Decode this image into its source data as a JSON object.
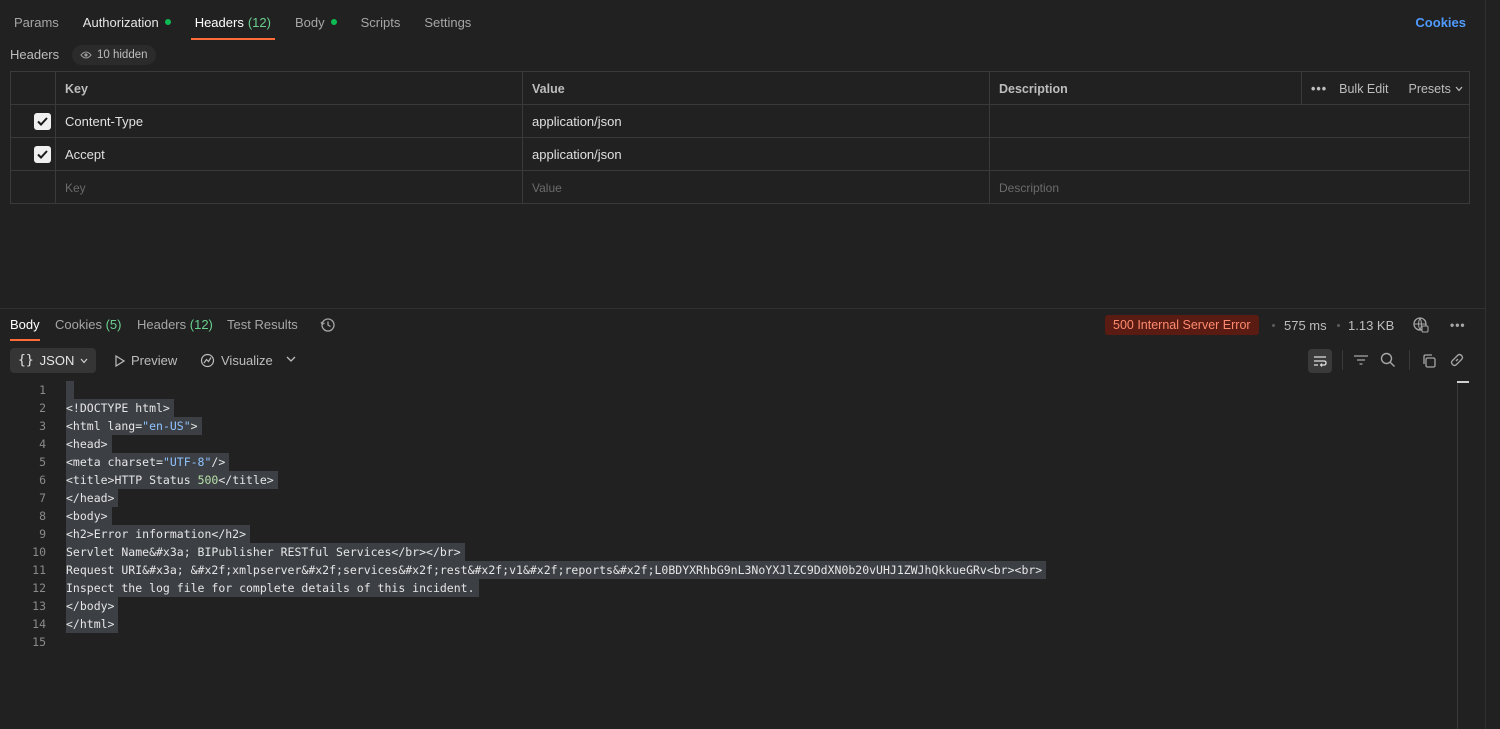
{
  "request_tabs": [
    {
      "label": "Params"
    },
    {
      "label": "Authorization",
      "dot": true
    },
    {
      "label": "Headers",
      "count": "(12)",
      "active": true
    },
    {
      "label": "Body",
      "dot": true
    },
    {
      "label": "Scripts"
    },
    {
      "label": "Settings"
    }
  ],
  "cookies_link": "Cookies",
  "headers_section": {
    "title": "Headers",
    "hidden_label": "10 hidden",
    "columns": {
      "key": "Key",
      "value": "Value",
      "description": "Description"
    },
    "bulk_edit": "Bulk Edit",
    "presets": "Presets",
    "rows": [
      {
        "key": "Content-Type",
        "value": "application/json",
        "description": "",
        "checked": true
      },
      {
        "key": "Accept",
        "value": "application/json",
        "description": "",
        "checked": true
      }
    ],
    "placeholders": {
      "key": "Key",
      "value": "Value",
      "description": "Description"
    }
  },
  "response": {
    "tabs": {
      "body": "Body",
      "cookies": "Cookies",
      "cookies_count": "(5)",
      "headers": "Headers",
      "headers_count": "(12)",
      "test_results": "Test Results"
    },
    "status": "500 Internal Server Error",
    "time": "575 ms",
    "size": "1.13 KB",
    "format": "JSON",
    "preview": "Preview",
    "visualize": "Visualize",
    "lines": [
      "1",
      "2",
      "3",
      "4",
      "5",
      "6",
      "7",
      "8",
      "9",
      "10",
      "11",
      "12",
      "13",
      "14",
      "15"
    ],
    "code": {
      "l2": "<!DOCTYPE html>",
      "l3a": "<html lang=",
      "l3b": "\"en-US\"",
      "l3c": ">",
      "l4": "<head>",
      "l5a": "<meta charset=",
      "l5b": "\"UTF-8\"",
      "l5c": "/>",
      "l6a": "<title>HTTP Status ",
      "l6b": "500",
      "l6c": "</title>",
      "l7": "</head>",
      "l8": "<body>",
      "l9": "<h2>Error information</h2>",
      "l10": "Servlet Name&#x3a; BIPublisher RESTful Services</br></br>",
      "l11": "Request URI&#x3a; &#x2f;xmlpserver&#x2f;services&#x2f;rest&#x2f;v1&#x2f;reports&#x2f;L0BDYXRhbG9nL3NoYXJlZC9DdXN0b20vUHJ1ZWJhQkkueGRv<br><br>",
      "l12": "Inspect the log file for complete details of this incident.",
      "l13": "</body>",
      "l14": "</html>"
    }
  }
}
